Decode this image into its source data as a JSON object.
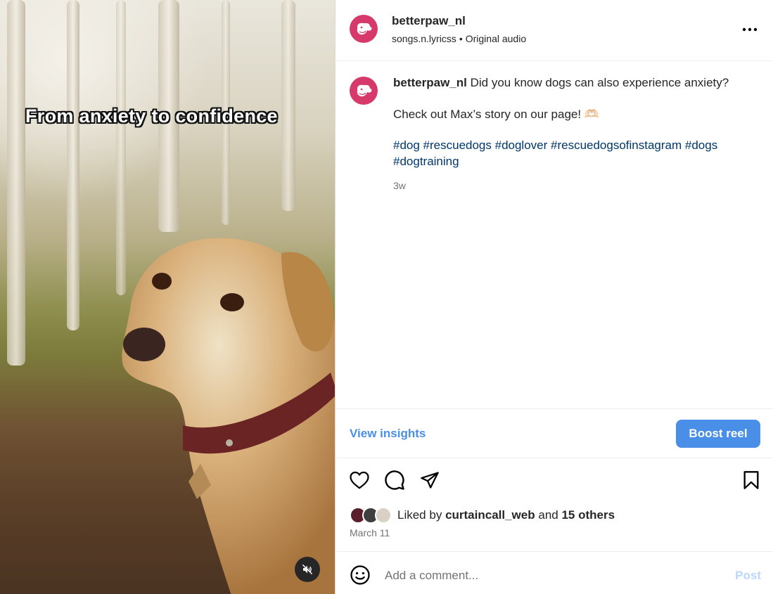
{
  "media": {
    "caption_overlay": "From anxiety to confidence",
    "mute_icon": "speaker-muted-icon"
  },
  "header": {
    "username": "betterpaw_nl",
    "audio_artist": "songs.n.lyricss",
    "separator": "•",
    "audio_label": "Original audio",
    "more_icon": "more-horizontal-icon"
  },
  "caption": {
    "username": "betterpaw_nl",
    "text": "Did you know dogs can also experience anxiety?",
    "line2": "Check out Max’s story on our page! 🫶🏻",
    "hashtags": "#dog #rescuedogs #doglover #rescuedogsofinstagram #dogs #dogtraining",
    "time_ago": "3w"
  },
  "insights": {
    "view_label": "View insights",
    "boost_label": "Boost reel"
  },
  "actions": {
    "like_icon": "heart-icon",
    "comment_icon": "comment-bubble-icon",
    "share_icon": "paper-plane-icon",
    "save_icon": "bookmark-icon"
  },
  "likes": {
    "prefix": "Liked by",
    "user": "curtaincall_web",
    "joiner": "and",
    "others": "15 others"
  },
  "post_date": "March 11",
  "comment": {
    "placeholder": "Add a comment...",
    "post_label": "Post",
    "emoji_icon": "smiley-face-icon"
  },
  "colors": {
    "brand_avatar": "#d63a6a",
    "accent_blue": "#4a8fe7",
    "hashtag": "#00376b",
    "secondary_text": "#737373",
    "post_disabled": "#b9d7fb"
  }
}
